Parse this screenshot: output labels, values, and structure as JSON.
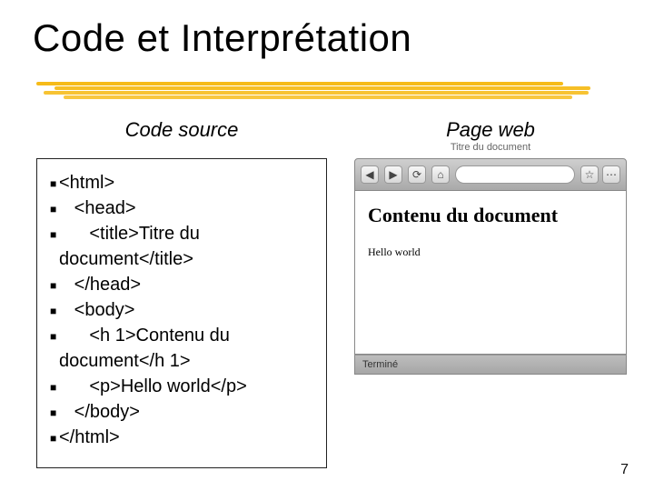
{
  "title": "Code et Interprétation",
  "left": {
    "heading": "Code source",
    "lines": [
      {
        "indent": "",
        "text": "<html>"
      },
      {
        "indent": "   ",
        "text": "<head>"
      },
      {
        "indent": "      ",
        "text": "<title>Titre du"
      },
      {
        "indent": "",
        "text": "document</title>",
        "nobullet": true
      },
      {
        "indent": "   ",
        "text": "</head>"
      },
      {
        "indent": "   ",
        "text": "<body>"
      },
      {
        "indent": "      ",
        "text": "<h 1>Contenu du"
      },
      {
        "indent": "",
        "text": "document</h 1>",
        "nobullet": true
      },
      {
        "indent": "      ",
        "text": "<p>Hello world</p>"
      },
      {
        "indent": "   ",
        "text": "</body>"
      },
      {
        "indent": "",
        "text": "</html>"
      }
    ]
  },
  "right": {
    "heading": "Page web",
    "browser": {
      "windowTitle": "Titre du document",
      "status": "Terminé"
    },
    "rendered": {
      "h1": "Contenu du document",
      "p": "Hello world"
    }
  },
  "pageNumber": "7"
}
